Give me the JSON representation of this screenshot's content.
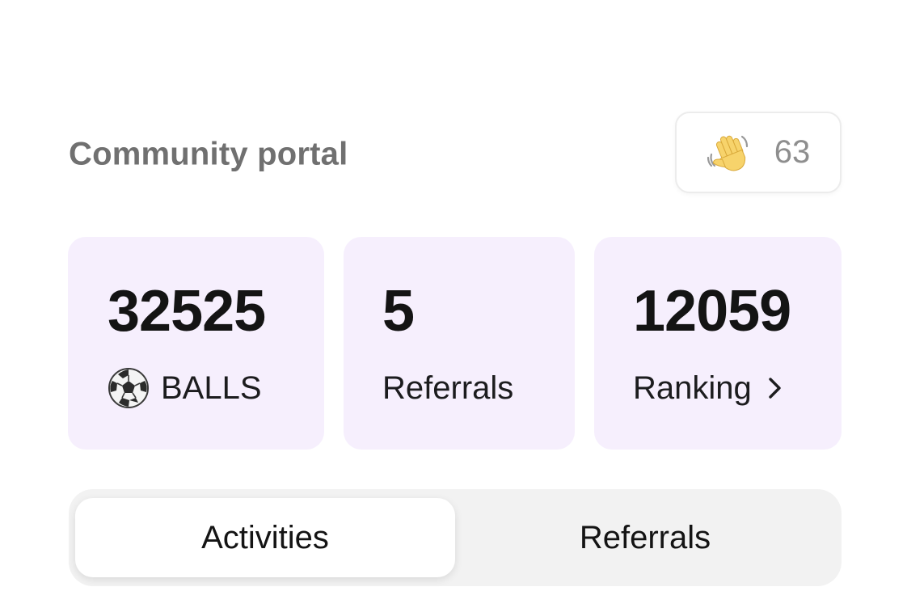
{
  "header": {
    "title": "Community portal",
    "wave": {
      "icon": "waving-hand-icon",
      "count": "63"
    }
  },
  "stats": {
    "balls": {
      "value": "32525",
      "label": "BALLS",
      "icon": "soccer-ball-icon"
    },
    "referrals": {
      "value": "5",
      "label": "Referrals"
    },
    "ranking": {
      "value": "12059",
      "label": "Ranking",
      "icon": "chevron-right-icon"
    }
  },
  "tabs": [
    {
      "label": "Activities",
      "selected": true
    },
    {
      "label": "Referrals",
      "selected": false
    }
  ],
  "colors": {
    "card_background": "#f6effd",
    "segmented_background": "#f2f2f2",
    "title_gray": "#707070",
    "count_gray": "#8e8e8e"
  }
}
